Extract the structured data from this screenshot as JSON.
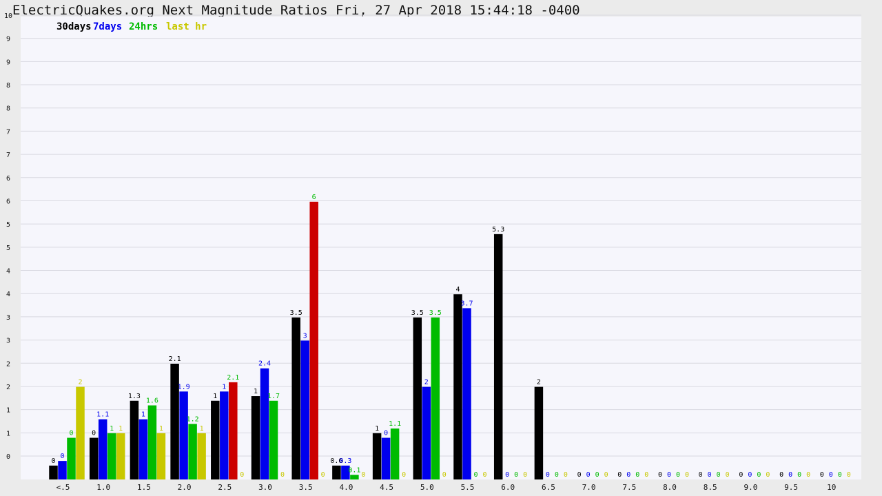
{
  "title": "ElectricQuakes.org Next Magnitude Ratios Fri, 27 Apr 2018 15:44:18 -0400",
  "chart_data": {
    "type": "bar",
    "categories": [
      "<.5",
      "1.0",
      "1.5",
      "2.0",
      "2.5",
      "3.0",
      "3.5",
      "4.0",
      "4.5",
      "5.0",
      "5.5",
      "6.0",
      "6.5",
      "7.0",
      "7.5",
      "8.0",
      "8.5",
      "9.0",
      "9.5",
      "10"
    ],
    "y_ticks": [
      "0",
      "1",
      "1",
      "2",
      "2",
      "3",
      "3",
      "4",
      "4",
      "5",
      "5",
      "6",
      "6",
      "7",
      "7",
      "8",
      "8",
      "9",
      "9",
      "10"
    ],
    "ylim": [
      0,
      10
    ],
    "series": [
      {
        "name": "30days",
        "color": "#000000",
        "values": [
          0.3,
          0.9,
          1.7,
          2.5,
          1.7,
          1.8,
          3.5,
          0.3,
          1.0,
          3.5,
          4.0,
          5.3,
          2.0,
          0,
          0,
          0,
          0,
          0,
          0,
          0
        ],
        "labels": [
          "0",
          "0",
          "1.3",
          "2.1",
          "1",
          "1",
          "3.5",
          "0.6",
          "1",
          "3.5",
          "4",
          "5.3",
          "2",
          "0",
          "0",
          "0",
          "0",
          "0",
          "0",
          "0"
        ]
      },
      {
        "name": "7days",
        "color": "#0000ee",
        "values": [
          0.4,
          1.3,
          1.3,
          1.9,
          1.9,
          2.4,
          3.0,
          0.3,
          0.9,
          2.0,
          3.7,
          0,
          0,
          0,
          0,
          0,
          0,
          0,
          0,
          0
        ],
        "labels": [
          "0",
          "1.1",
          "1",
          "1.9",
          "1",
          "2.4",
          "3",
          "0.3",
          "0",
          "2",
          "3.7",
          "0",
          "0",
          "0",
          "0",
          "0",
          "0",
          "0",
          "0",
          "0"
        ]
      },
      {
        "name": "24hrs",
        "color": "#00bb00",
        "values": [
          0.9,
          1.0,
          1.6,
          1.2,
          2.1,
          1.7,
          6.0,
          0.1,
          1.1,
          3.5,
          0,
          0,
          0,
          0,
          0,
          0,
          0,
          0,
          0,
          0
        ],
        "labels": [
          "0",
          "1",
          "1.6",
          "1.2",
          "2.1",
          "1.7",
          "6",
          "0.1",
          "1.1",
          "3.5",
          "0",
          "0",
          "0",
          "0",
          "0",
          "0",
          "0",
          "0",
          "0",
          "0"
        ],
        "bar_colors": {
          "4": "#cc0000",
          "6": "#cc0000"
        }
      },
      {
        "name": "last hr",
        "color": "#c8c800",
        "values": [
          2,
          1,
          1,
          1,
          0,
          0,
          0,
          0,
          0,
          0,
          0,
          0,
          0,
          0,
          0,
          0,
          0,
          0,
          0,
          0
        ],
        "labels": [
          "2",
          "1",
          "1",
          "1",
          "0",
          "0",
          "0",
          "0",
          "0",
          "0",
          "0",
          "0",
          "0",
          "0",
          "0",
          "0",
          "0",
          "0",
          "0",
          "0"
        ]
      }
    ]
  }
}
